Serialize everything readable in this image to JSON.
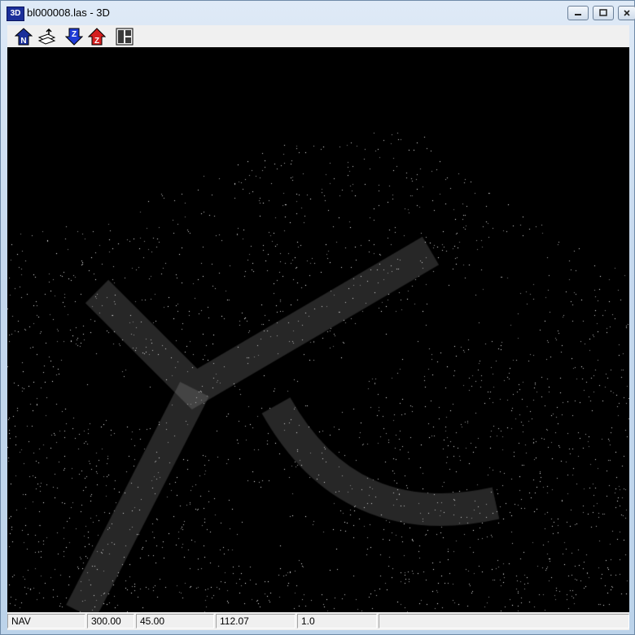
{
  "window": {
    "app_icon_label": "3D",
    "title": "bl000008.las - 3D"
  },
  "toolbar": {
    "buttons": [
      {
        "name": "north-view",
        "icon": "north-arrow-icon",
        "label": "N"
      },
      {
        "name": "load-points",
        "icon": "layers-load-icon",
        "label": ""
      },
      {
        "name": "z-down",
        "icon": "z-down-arrow-icon",
        "label": "Z"
      },
      {
        "name": "z-up",
        "icon": "z-up-arrow-icon",
        "label": "Z"
      },
      {
        "name": "layout",
        "icon": "split-panels-icon",
        "label": ""
      }
    ]
  },
  "statusbar": {
    "mode": "NAV",
    "value1": "300.00",
    "value2": "45.00",
    "value3": "112.07",
    "value4": "1.0"
  },
  "colors": {
    "z_down_blue": "#1f3bd6",
    "z_up_red": "#d61f1f",
    "north_blue": "#1b2f9a",
    "points": "#d8d8d8"
  }
}
